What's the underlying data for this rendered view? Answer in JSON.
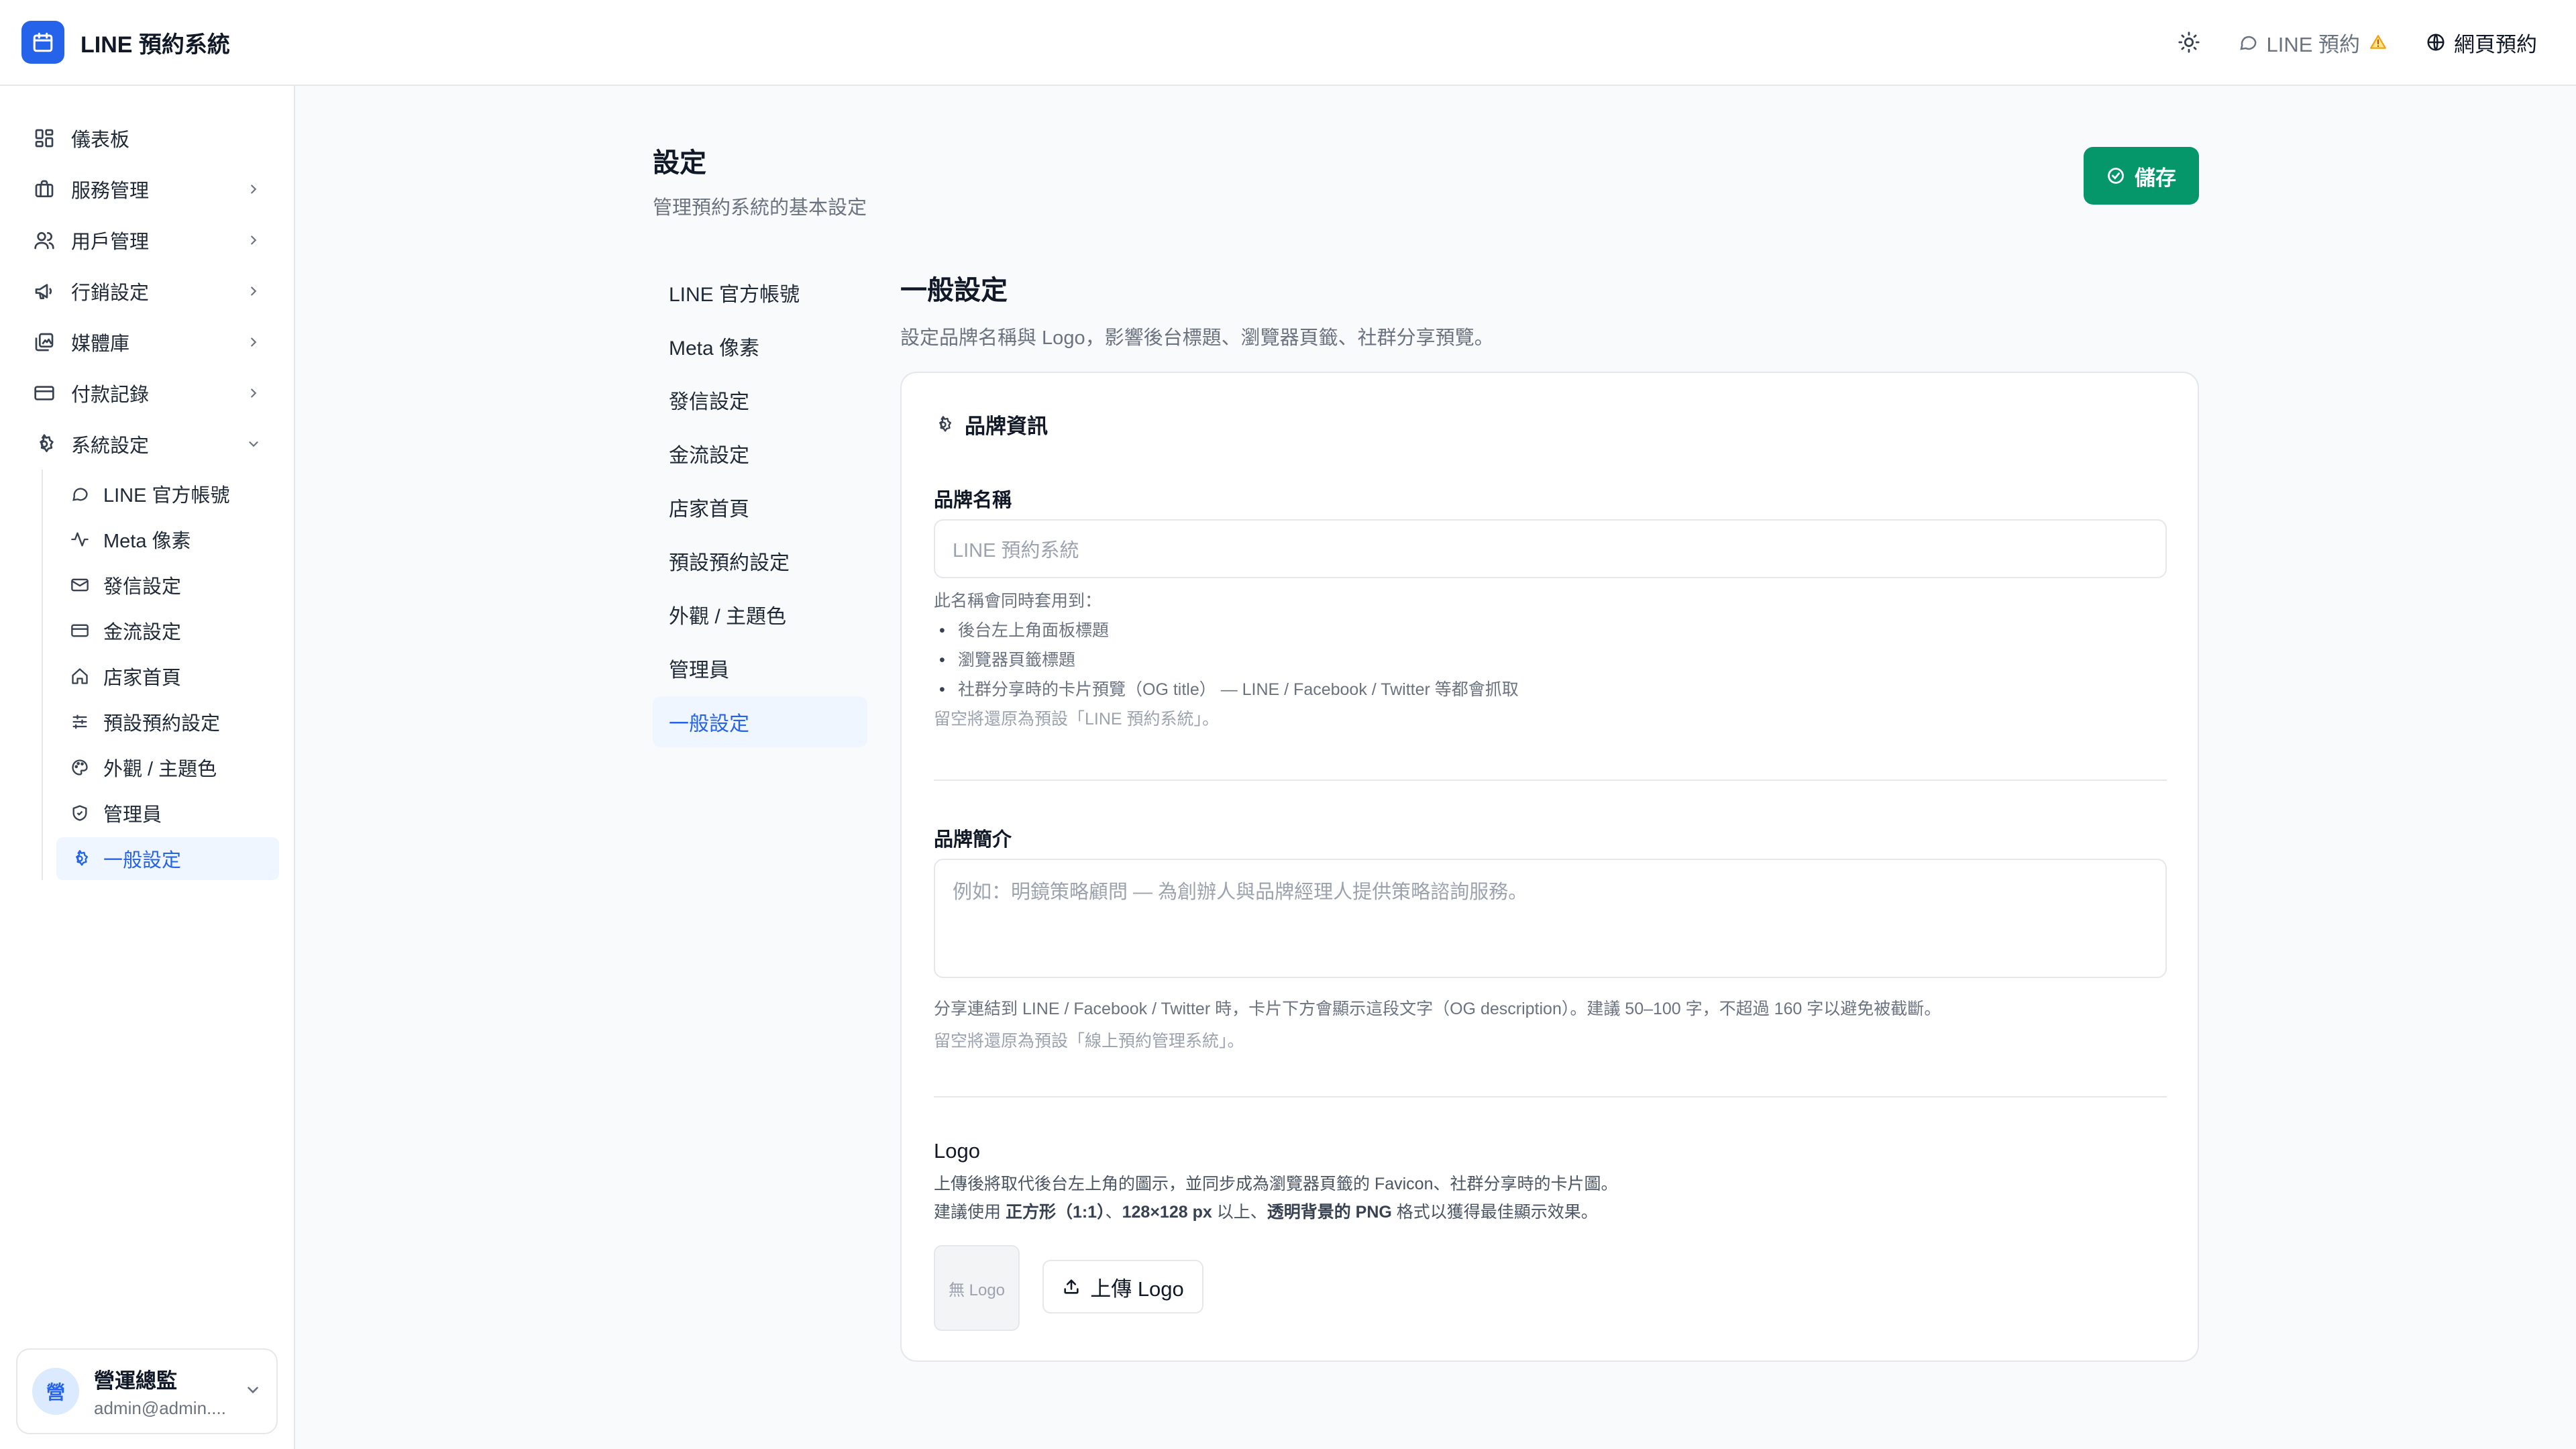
{
  "app": {
    "title": "LINE 預約系統"
  },
  "topbar": {
    "line_label": "LINE 預約",
    "web_label": "網頁預約"
  },
  "sidebar": {
    "items": [
      {
        "label": "儀表板",
        "icon": "dashboard-icon"
      },
      {
        "label": "服務管理",
        "icon": "briefcase-icon"
      },
      {
        "label": "用戶管理",
        "icon": "users-icon"
      },
      {
        "label": "行銷設定",
        "icon": "megaphone-icon"
      },
      {
        "label": "媒體庫",
        "icon": "media-icon"
      },
      {
        "label": "付款記錄",
        "icon": "credit-card-icon"
      },
      {
        "label": "系統設定",
        "icon": "settings-icon"
      }
    ],
    "sub_items": [
      {
        "label": "LINE 官方帳號",
        "icon": "chat-icon"
      },
      {
        "label": "Meta 像素",
        "icon": "activity-icon"
      },
      {
        "label": "發信設定",
        "icon": "mail-icon"
      },
      {
        "label": "金流設定",
        "icon": "credit-card-icon"
      },
      {
        "label": "店家首頁",
        "icon": "home-icon"
      },
      {
        "label": "預設預約設定",
        "icon": "sliders-icon"
      },
      {
        "label": "外觀 / 主題色",
        "icon": "palette-icon"
      },
      {
        "label": "管理員",
        "icon": "shield-icon"
      },
      {
        "label": "一般設定",
        "icon": "gear-icon"
      }
    ],
    "user": {
      "avatar": "營",
      "name": "營運總監",
      "email": "admin@admin...."
    }
  },
  "page": {
    "title": "設定",
    "subtitle": "管理預約系統的基本設定",
    "save_label": "儲存"
  },
  "settings_nav": [
    "LINE 官方帳號",
    "Meta 像素",
    "發信設定",
    "金流設定",
    "店家首頁",
    "預設預約設定",
    "外觀 / 主題色",
    "管理員",
    "一般設定"
  ],
  "section": {
    "title": "一般設定",
    "subtitle": "設定品牌名稱與 Logo，影響後台標題、瀏覽器頁籤、社群分享預覽。",
    "card_title": "品牌資訊",
    "brand_name": {
      "label": "品牌名稱",
      "placeholder": "LINE 預約系統",
      "help_intro": "此名稱會同時套用到：",
      "help_items": [
        "後台左上角面板標題",
        "瀏覽器頁籤標題",
        "社群分享時的卡片預覽（OG title） — LINE / Facebook / Twitter 等都會抓取"
      ],
      "help_default": "留空將還原為預設「LINE 預約系統」。"
    },
    "brand_intro": {
      "label": "品牌簡介",
      "placeholder": "例如：明鏡策略顧問 — 為創辦人與品牌經理人提供策略諮詢服務。",
      "help": "分享連結到 LINE / Facebook / Twitter 時，卡片下方會顯示這段文字（OG description）。建議 50–100 字，不超過 160 字以避免被截斷。",
      "help_default": "留空將還原為預設「線上預約管理系統」。"
    },
    "logo": {
      "label": "Logo",
      "help1": "上傳後將取代後台左上角的圖示，並同步成為瀏覽器頁籤的 Favicon、社群分享時的卡片圖。",
      "help2_pre": "建議使用 ",
      "help2_b1": "正方形（1:1）",
      "help2_mid1": "、",
      "help2_b2": "128×128 px",
      "help2_mid2": " 以上、",
      "help2_b3": "透明背景的 PNG",
      "help2_post": " 格式以獲得最佳顯示效果。",
      "placeholder": "無 Logo",
      "upload_label": "上傳 Logo"
    }
  },
  "colors": {
    "primary": "#2563eb",
    "success": "#059669",
    "warning": "#f59e0b"
  }
}
